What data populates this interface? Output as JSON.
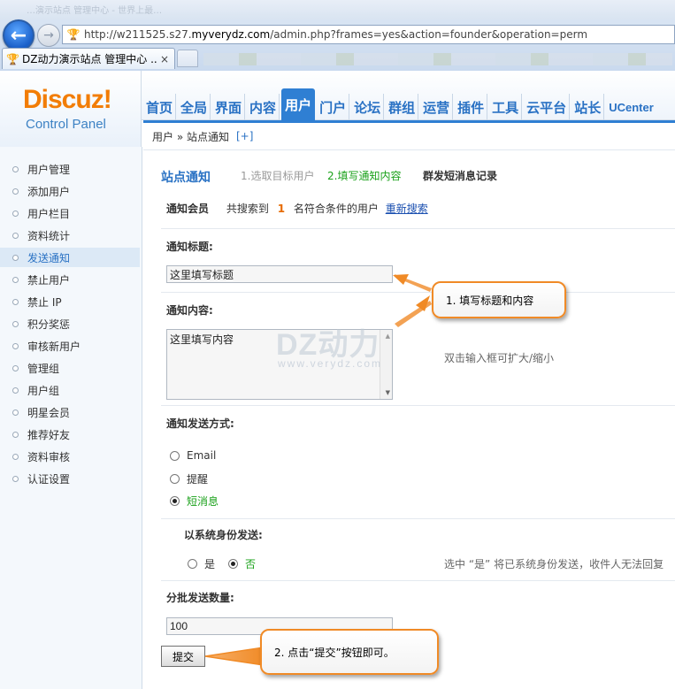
{
  "browser": {
    "faded_title": "…演示站点 管理中心 - 世界上最…",
    "address_prefix": "http://w211525.s27.",
    "address_domain": "myverydz.com",
    "address_suffix": "/admin.php?frames=yes&action=founder&operation=perm",
    "tab_title": "DZ动力演示站点 管理中心 ...",
    "tab_close": "×",
    "back_icon": "←",
    "forward_icon": "→"
  },
  "logo": {
    "main": "Discuz!",
    "sub": "Control Panel"
  },
  "topnav": [
    {
      "label": "首页"
    },
    {
      "label": "全局"
    },
    {
      "label": "界面"
    },
    {
      "label": "内容"
    },
    {
      "label": "用户",
      "active": true
    },
    {
      "label": "门户"
    },
    {
      "label": "论坛"
    },
    {
      "label": "群组"
    },
    {
      "label": "运营"
    },
    {
      "label": "插件"
    },
    {
      "label": "工具"
    },
    {
      "label": "云平台"
    },
    {
      "label": "站长"
    },
    {
      "label": "UCenter"
    }
  ],
  "breadcrumb": {
    "text": "用户 » 站点通知",
    "plus": "[+]"
  },
  "sidebar": {
    "items": [
      {
        "label": "用户管理"
      },
      {
        "label": "添加用户"
      },
      {
        "label": "用户栏目"
      },
      {
        "label": "资料统计"
      },
      {
        "label": "发送通知",
        "active": true
      },
      {
        "label": "禁止用户"
      },
      {
        "label": "禁止 IP"
      },
      {
        "label": "积分奖惩"
      },
      {
        "label": "审核新用户"
      },
      {
        "label": "管理组"
      },
      {
        "label": "用户组"
      },
      {
        "label": "明星会员"
      },
      {
        "label": "推荐好友"
      },
      {
        "label": "资料审核"
      },
      {
        "label": "认证设置"
      }
    ]
  },
  "main": {
    "title": "站点通知",
    "step1": "1.选取目标用户",
    "step2": "2.填写通知内容",
    "step3": "群发短消息记录",
    "members_label": "通知会员",
    "members_prefix": "共搜索到",
    "members_count": "1",
    "members_suffix": "名符合条件的用户",
    "research_link": "重新搜索",
    "title_label": "通知标题:",
    "title_value": "这里填写标题",
    "content_label": "通知内容:",
    "content_value": "这里填写内容",
    "content_hint": "双击输入框可扩大/缩小",
    "method_label": "通知发送方式:",
    "method_options": [
      {
        "label": "Email",
        "checked": false
      },
      {
        "label": "提醒",
        "checked": false
      },
      {
        "label": "短消息",
        "checked": true
      }
    ],
    "system_label": "以系统身份发送:",
    "system_yes": "是",
    "system_no": "否",
    "system_hint": "选中 “是” 将已系统身份发送，收件人无法回复",
    "batch_label": "分批发送数量:",
    "batch_value": "100",
    "submit_label": "提交"
  },
  "watermark": {
    "main": "DZ动力",
    "sub": "www.verydz.com"
  },
  "callouts": {
    "first": "1. 填写标题和内容",
    "second": "2. 点击“提交”按钮即可。"
  },
  "colors": {
    "accent": "#2f7fd3",
    "logo": "#f27d06",
    "callout_border": "#f08a26",
    "success": "#1aa11a"
  }
}
